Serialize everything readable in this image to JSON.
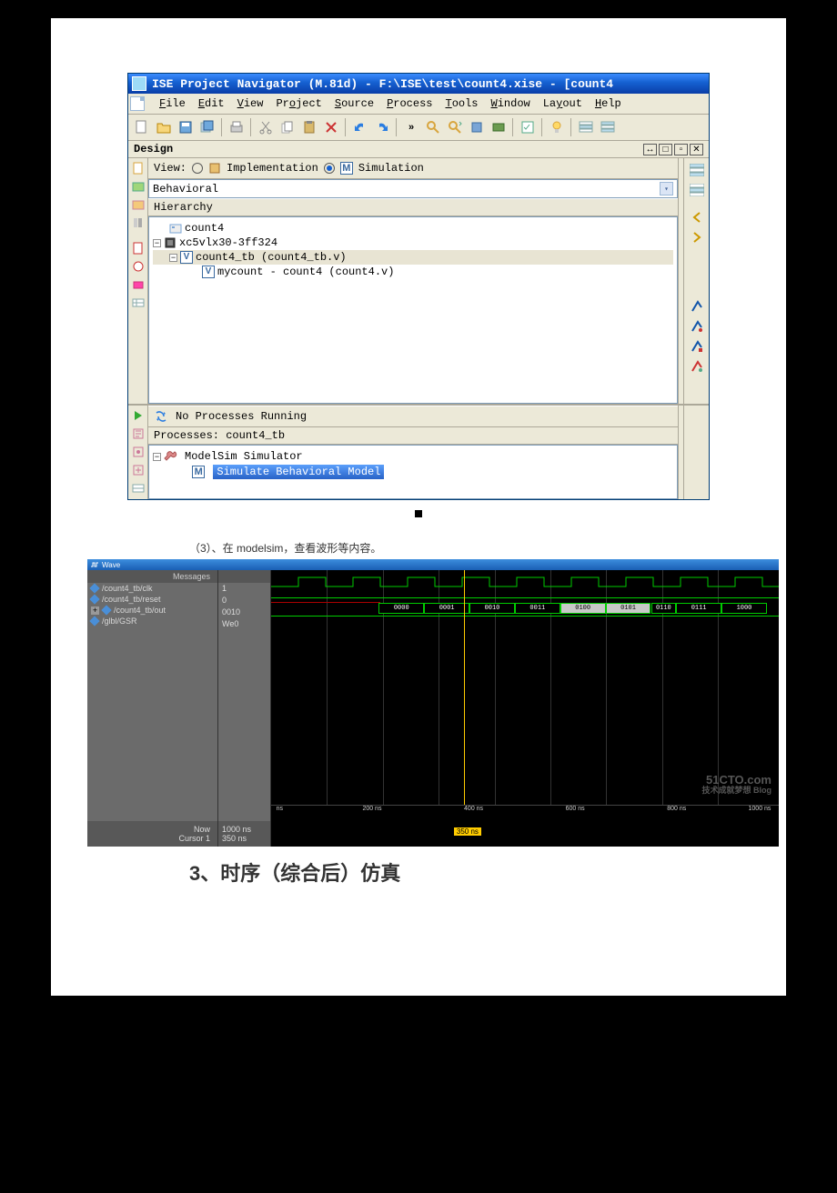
{
  "ise": {
    "title": "ISE Project Navigator (M.81d) - F:\\ISE\\test\\count4.xise - [count4",
    "menu": {
      "file": "File",
      "edit": "Edit",
      "view": "View",
      "project": "Project",
      "source": "Source",
      "process": "Process",
      "tools": "Tools",
      "window": "Window",
      "layout": "Layout",
      "help": "Help"
    },
    "panel_title": "Design",
    "view_label": "View:",
    "impl_label": "Implementation",
    "sim_label": "Simulation",
    "dropdown_value": "Behavioral",
    "hierarchy_label": "Hierarchy",
    "tree": {
      "project": "count4",
      "device": "xc5vlx30-3ff324",
      "tb": "count4_tb (count4_tb.v)",
      "inst": "mycount - count4 (count4.v)"
    },
    "no_proc": "No Processes Running",
    "proc_header": "Processes: count4_tb",
    "sim_group": "ModelSim Simulator",
    "sim_action": "Simulate Behavioral Model"
  },
  "caption": "（3）、在 modelsim，查看波形等内容。",
  "modelsim": {
    "tab": "Wave",
    "sig_header": "Messages",
    "signals": [
      "/count4_tb/clk",
      "/count4_tb/reset",
      "/count4_tb/out",
      "/glbl/GSR"
    ],
    "values": [
      "1",
      "0",
      "0010",
      "We0"
    ],
    "bus_vals": [
      "0000",
      "0001",
      "0010",
      "0011",
      "0100",
      "0101",
      "0110",
      "0111",
      "1000"
    ],
    "ticks": [
      "ns",
      "200 ns",
      "400 ns",
      "600 ns",
      "800 ns",
      "1000 ns"
    ],
    "now_label": "Now",
    "now_val": "1000 ns",
    "cursor_label": "Cursor 1",
    "cursor_val": "350 ns",
    "cursor_flag": "350 ns",
    "watermark1": "51CTO.com",
    "watermark2": "技术成就梦想 Blog"
  },
  "heading": "3、时序（综合后）仿真"
}
